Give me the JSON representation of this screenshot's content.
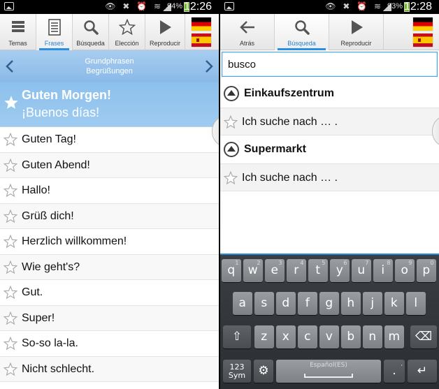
{
  "left": {
    "status": {
      "battery": "94%",
      "time": "12:26",
      "icons": "👁 ✖ ⏰ ≋"
    },
    "toolbar": [
      {
        "label": "Temas",
        "icon": "list-icon",
        "active": false
      },
      {
        "label": "Frases",
        "icon": "document-icon",
        "active": true
      },
      {
        "label": "Búsqueda",
        "icon": "search-icon",
        "active": false
      },
      {
        "label": "Elección",
        "icon": "star-icon",
        "active": false
      },
      {
        "label": "Reproducir",
        "icon": "play-icon",
        "active": false
      }
    ],
    "nav": {
      "line1": "Grundphrasen",
      "line2": "Begrüßungen"
    },
    "selected": {
      "german": "Guten Morgen!",
      "spanish": "¡Buenos días!"
    },
    "phrases": [
      "Guten Tag!",
      "Guten Abend!",
      "Hallo!",
      "Grüß dich!",
      "Herzlich willkommen!",
      "Wie geht's?",
      "Gut.",
      "Super!",
      "So-so la-la.",
      "Nicht schlecht."
    ]
  },
  "right": {
    "status": {
      "battery": "93%",
      "time": "12:28",
      "icons": "👁 ✖ ⏰ ≋"
    },
    "toolbar": [
      {
        "label": "Atrás",
        "icon": "back-arrow-icon",
        "active": false
      },
      {
        "label": "Búsqueda",
        "icon": "search-icon",
        "active": true
      },
      {
        "label": "Reproducir",
        "icon": "play-icon",
        "active": false
      }
    ],
    "search": {
      "value": "busco"
    },
    "results": [
      {
        "heading": "Einkaufszentrum",
        "phrase": "Ich suche nach … ."
      },
      {
        "heading": "Supermarkt",
        "phrase": "Ich suche nach … ."
      }
    ],
    "keyboard": {
      "row1": [
        {
          "k": "q",
          "n": "1"
        },
        {
          "k": "w",
          "n": "2"
        },
        {
          "k": "e",
          "n": "3"
        },
        {
          "k": "r",
          "n": "4"
        },
        {
          "k": "t",
          "n": "5"
        },
        {
          "k": "y",
          "n": "6"
        },
        {
          "k": "u",
          "n": "7"
        },
        {
          "k": "i",
          "n": "8"
        },
        {
          "k": "o",
          "n": "9"
        },
        {
          "k": "p",
          "n": "0"
        }
      ],
      "row2": [
        "a",
        "s",
        "d",
        "f",
        "g",
        "h",
        "j",
        "k",
        "l"
      ],
      "row3": [
        "z",
        "x",
        "c",
        "v",
        "b",
        "n",
        "m"
      ],
      "sym_label_1": "123",
      "sym_label_2": "Sym",
      "space_label": "Español(ES)",
      "period": ".",
      "period_hint": ",",
      "shift": "⇧",
      "backspace": "⌫",
      "settings": "⚙",
      "enter": "↵"
    }
  }
}
